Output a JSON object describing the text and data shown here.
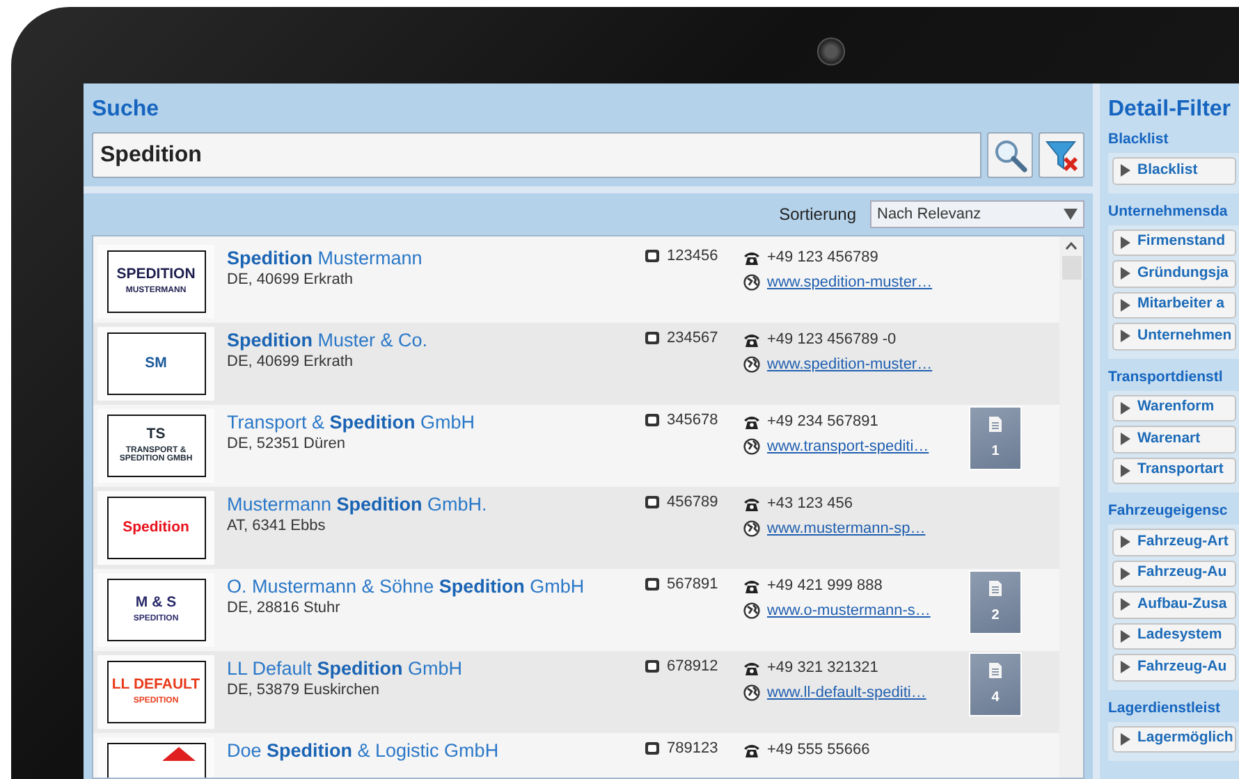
{
  "search": {
    "title": "Suche",
    "value": "Spedition"
  },
  "sort": {
    "label": "Sortierung",
    "value": "Nach Relevanz"
  },
  "results": [
    {
      "name": "**Spedition** Mustermann",
      "location": "DE, 40699 Erkrath",
      "id": "123456",
      "phone": "+49 123 456789",
      "website": "www.spedition-muster…",
      "logo": {
        "lines": [
          "SPEDITION",
          "MUSTERMANN"
        ],
        "color": "#1f1f4f"
      }
    },
    {
      "name": "**Spedition** Muster & Co.",
      "location": "DE, 40699 Erkrath",
      "id": "234567",
      "phone": "+49 123 456789 -0",
      "website": "www.spedition-muster…",
      "logo": {
        "lines": [
          "SM"
        ],
        "color": "#1a5a9a"
      }
    },
    {
      "name": "Transport & **Spedition** GmbH",
      "location": "DE, 52351 Düren",
      "id": "345678",
      "phone": "+49 234 567891",
      "website": "www.transport-spediti…",
      "documents": "1",
      "logo": {
        "lines": [
          "TS",
          "TRANSPORT & SPEDITION GMBH"
        ],
        "color": "#1e2a36"
      }
    },
    {
      "name": "Mustermann **Spedition** GmbH.",
      "location": "AT, 6341 Ebbs",
      "id": "456789",
      "phone": "+43 123 456",
      "website": "www.mustermann-sp…",
      "logo": {
        "lines": [
          "Spedition"
        ],
        "color": "#e8101a"
      }
    },
    {
      "name": "O. Mustermann & Söhne **Spedition** GmbH",
      "location": "DE, 28816 Stuhr",
      "id": "567891",
      "phone": "+49 421 999 888",
      "website": "www.o-mustermann-s…",
      "documents": "2",
      "logo": {
        "lines": [
          "M & S",
          "SPEDITION"
        ],
        "color": "#2a2a6a"
      }
    },
    {
      "name": "LL Default **Spedition** GmbH",
      "location": "DE, 53879 Euskirchen",
      "id": "678912",
      "phone": "+49 321 321321",
      "website": "www.ll-default-spediti…",
      "documents": "4",
      "logo": {
        "lines": [
          "LL DEFAULT",
          "SPEDITION"
        ],
        "color": "#e83a1a"
      }
    },
    {
      "name": "Doe **Spedition** & Logistic GmbH",
      "id": "789123",
      "phone": "+49 555 55666",
      "logo": {
        "color": "#e02020"
      }
    }
  ],
  "detail_filter": {
    "title": "Detail-Filter",
    "groups": [
      {
        "title": "Blacklist",
        "items": [
          "Blacklist"
        ]
      },
      {
        "title": "Unternehmensda",
        "items": [
          "Firmenstand",
          "Gründungsja",
          "Mitarbeiter a",
          "Unternehmen"
        ]
      },
      {
        "title": "Transportdienstl",
        "items": [
          "Warenform",
          "Warenart",
          "Transportart"
        ]
      },
      {
        "title": "Fahrzeugeigensc",
        "items": [
          "Fahrzeug-Art",
          "Fahrzeug-Au",
          "Aufbau-Zusa",
          "Ladesystem",
          "Fahrzeug-Au"
        ]
      },
      {
        "title": "Lagerdienstleist",
        "items": [
          "Lagermöglich"
        ]
      }
    ]
  }
}
